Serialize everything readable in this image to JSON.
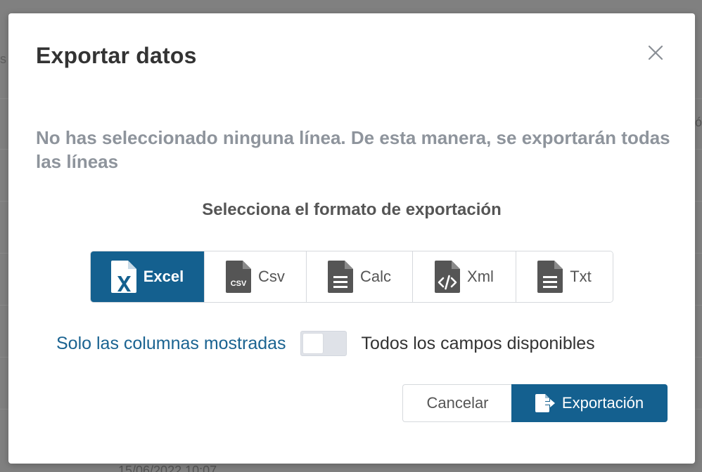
{
  "modal": {
    "title": "Exportar datos",
    "notice": "No has seleccionado ninguna línea. De esta manera, se exportarán todas las líneas",
    "format_heading": "Selecciona el formato de exportación",
    "formats": [
      {
        "label": "Excel",
        "icon": "excel-file-icon",
        "selected": true
      },
      {
        "label": "Csv",
        "icon": "csv-file-icon",
        "selected": false
      },
      {
        "label": "Calc",
        "icon": "document-file-icon",
        "selected": false
      },
      {
        "label": "Xml",
        "icon": "code-file-icon",
        "selected": false
      },
      {
        "label": "Txt",
        "icon": "text-file-icon",
        "selected": false
      }
    ],
    "toggle": {
      "left_label": "Solo las columnas mostradas",
      "right_label": "Todos los campos disponibles",
      "checked": false
    },
    "buttons": {
      "cancel": "Cancelar",
      "export": "Exportación",
      "export_icon": "file-export-icon"
    }
  },
  "background": {
    "left_text": "s",
    "right_text": "ó",
    "bottom_text": "15/06/2022 10:07"
  },
  "colors": {
    "primary": "#14608f",
    "link": "#1a6391",
    "muted_text": "#8e949c",
    "heading_text": "#333333"
  }
}
